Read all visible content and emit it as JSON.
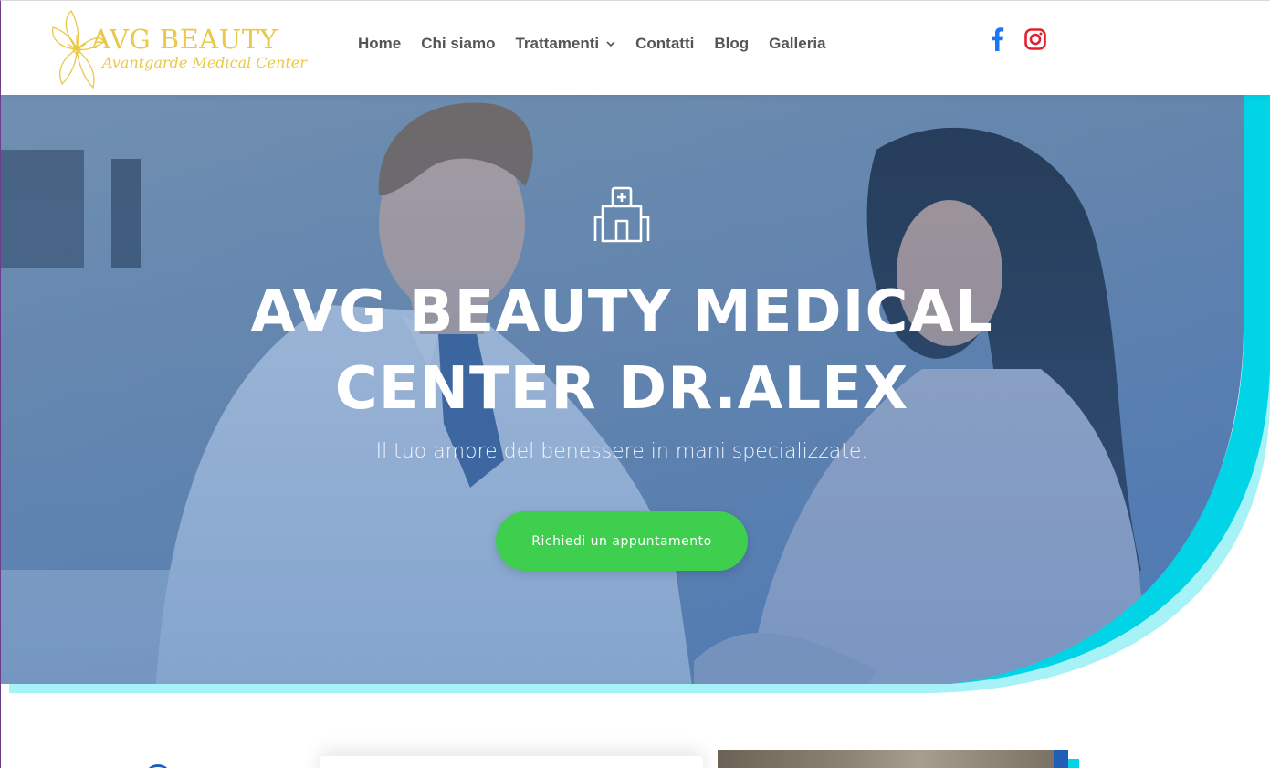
{
  "logo": {
    "title": "AVG BEAUTY",
    "subtitle": "Avantgarde Medical Center",
    "color": "#e9c84a"
  },
  "nav": {
    "items": [
      {
        "label": "Home"
      },
      {
        "label": "Chi siamo"
      },
      {
        "label": "Trattamenti",
        "has_dropdown": true
      },
      {
        "label": "Contatti"
      },
      {
        "label": "Blog"
      },
      {
        "label": "Galleria"
      }
    ],
    "chevron": "›"
  },
  "social": {
    "facebook_icon": "facebook-icon",
    "instagram_icon": "instagram-icon",
    "facebook_color": "#1877f2",
    "instagram_color": "#e4202e"
  },
  "hero": {
    "icon": "hospital-icon",
    "title": "AVG BEAUTY MEDICAL CENTER DR.ALEX",
    "subtitle": "Il tuo amore del benessere in mani specializzate.",
    "cta_label": "Richiedi un appuntamento",
    "cta_color": "#3ecf4e",
    "overlay_color": "#4a7dc0",
    "accent_cyan": "#00d4e6",
    "accent_light_cyan": "#a6f2f7"
  }
}
